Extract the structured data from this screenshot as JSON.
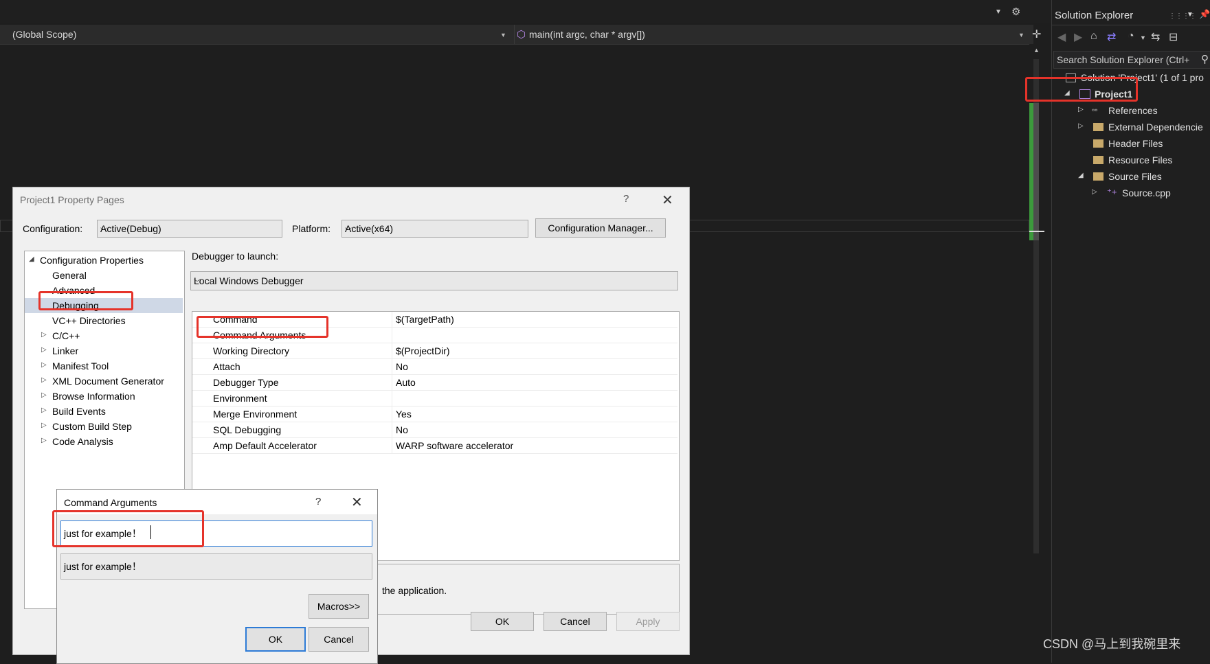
{
  "editor": {
    "scope_label": "(Global Scope)",
    "function_label": "main(int argc, char * argv[])"
  },
  "solution_explorer": {
    "title": "Solution Explorer",
    "search_placeholder": "Search Solution Explorer (Ctrl+",
    "tree": [
      {
        "label": "Solution 'Project1' (1 of 1 pro"
      },
      {
        "label": "Project1"
      },
      {
        "label": "References"
      },
      {
        "label": "External Dependencie"
      },
      {
        "label": "Header Files"
      },
      {
        "label": "Resource Files"
      },
      {
        "label": "Source Files"
      },
      {
        "label": "Source.cpp"
      }
    ]
  },
  "property_pages": {
    "title": "Project1 Property Pages",
    "help": "?",
    "close": "✕",
    "configuration_label": "Configuration:",
    "configuration_value": "Active(Debug)",
    "platform_label": "Platform:",
    "platform_value": "Active(x64)",
    "config_manager_button": "Configuration Manager...",
    "debugger_to_launch_label": "Debugger to launch:",
    "debugger_value": "Local Windows Debugger",
    "nav": [
      {
        "label": "Configuration Properties"
      },
      {
        "label": "General"
      },
      {
        "label": "Advanced"
      },
      {
        "label": "Debugging"
      },
      {
        "label": "VC++ Directories"
      },
      {
        "label": "C/C++"
      },
      {
        "label": "Linker"
      },
      {
        "label": "Manifest Tool"
      },
      {
        "label": "XML Document Generator"
      },
      {
        "label": "Browse Information"
      },
      {
        "label": "Build Events"
      },
      {
        "label": "Custom Build Step"
      },
      {
        "label": "Code Analysis"
      }
    ],
    "properties": [
      {
        "name": "Command",
        "value": "$(TargetPath)"
      },
      {
        "name": "Command Arguments",
        "value": ""
      },
      {
        "name": "Working Directory",
        "value": "$(ProjectDir)"
      },
      {
        "name": "Attach",
        "value": "No"
      },
      {
        "name": "Debugger Type",
        "value": "Auto"
      },
      {
        "name": "Environment",
        "value": ""
      },
      {
        "name": "Merge Environment",
        "value": "Yes"
      },
      {
        "name": "SQL Debugging",
        "value": "No"
      },
      {
        "name": "Amp Default Accelerator",
        "value": "WARP software accelerator"
      }
    ],
    "description_tail": "the application.",
    "ok": "OK",
    "cancel": "Cancel",
    "apply": "Apply"
  },
  "command_arguments_dialog": {
    "title": "Command Arguments",
    "help": "?",
    "close": "✕",
    "input_value": "just for example！",
    "preview_value": "just for example！",
    "macros_button": "Macros>>",
    "ok": "OK",
    "cancel": "Cancel"
  },
  "watermark": "CSDN @马上到我碗里来",
  "colors": {
    "highlight": "#e5332a",
    "selection": "#cfd8e6",
    "focus": "#2d7bd6"
  }
}
